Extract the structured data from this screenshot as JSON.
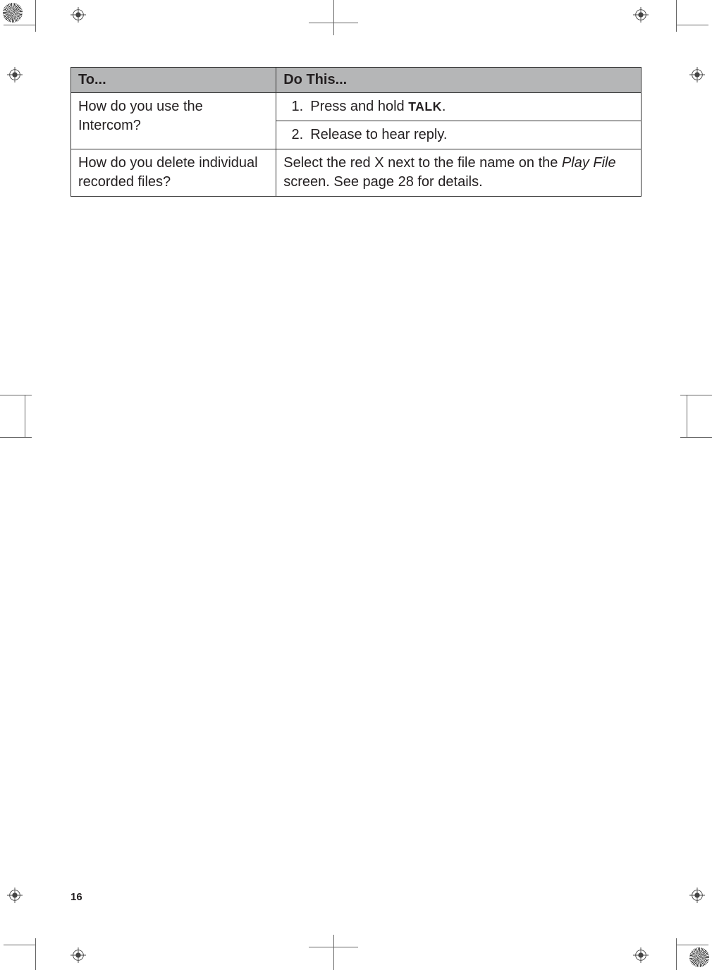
{
  "table": {
    "headers": {
      "to": "To...",
      "do_this": "Do This..."
    },
    "rows": [
      {
        "to": "How do you use the Intercom?",
        "steps": [
          {
            "num": "1.",
            "text_pre": "Press and hold ",
            "key": "TALK",
            "text_post": "."
          },
          {
            "num": "2.",
            "text_pre": "Release to hear reply.",
            "key": "",
            "text_post": ""
          }
        ]
      },
      {
        "to": "How do you delete individual recorded files?",
        "answer_pre": "Select the red X next to the file name on the ",
        "answer_italic": "Play File",
        "answer_post": " screen. See page 28 for details."
      }
    ]
  },
  "page_number": "16"
}
